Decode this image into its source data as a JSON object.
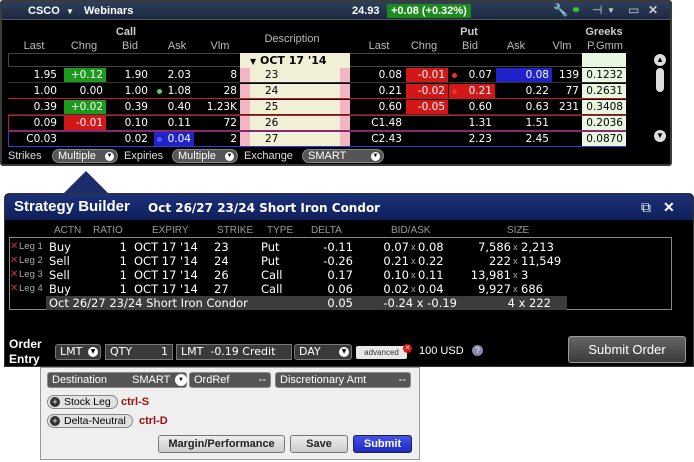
{
  "chain": {
    "symbol": "CSCO",
    "menu": "Webinars",
    "last_price": "24.93",
    "change": "+0.08 (+0.32%)",
    "headers": {
      "call_group": "Call",
      "put_group": "Put",
      "greeks_group": "Greeks",
      "description": "Description",
      "call_cols": [
        "Last",
        "Chng",
        "Bid",
        "Ask",
        "Vlm"
      ],
      "put_cols": [
        "Last",
        "Chng",
        "Bid",
        "Ask",
        "Vlm"
      ],
      "greek_col": "P.Gmm"
    },
    "expiry": "OCT 17 '14",
    "rows": [
      {
        "c_last": "1.95",
        "c_chng": "+0.12",
        "c_bid": "1.90",
        "c_ask": "2.03",
        "c_vlm": "8",
        "strike": "23",
        "p_last": "0.08",
        "p_chng": "-0.01",
        "p_bid": "0.07",
        "p_ask": "0.08",
        "p_vlm": "139",
        "gamma": "0.1232"
      },
      {
        "c_last": "1.00",
        "c_chng": "0.00",
        "c_bid": "1.00",
        "c_ask": "1.08",
        "c_vlm": "28",
        "strike": "24",
        "p_last": "0.21",
        "p_chng": "-0.02",
        "p_bid": "0.21",
        "p_ask": "0.22",
        "p_vlm": "77",
        "gamma": "0.2631"
      },
      {
        "c_last": "0.39",
        "c_chng": "+0.02",
        "c_bid": "0.39",
        "c_ask": "0.40",
        "c_vlm": "1.23K",
        "strike": "25",
        "p_last": "0.60",
        "p_chng": "-0.05",
        "p_bid": "0.60",
        "p_ask": "0.63",
        "p_vlm": "231",
        "gamma": "0.3408"
      },
      {
        "c_last": "0.09",
        "c_chng": "-0.01",
        "c_bid": "0.10",
        "c_ask": "0.11",
        "c_vlm": "72",
        "strike": "26",
        "p_last": "C1.48",
        "p_chng": "",
        "p_bid": "1.31",
        "p_ask": "1.51",
        "p_vlm": "",
        "gamma": "0.2036"
      },
      {
        "c_last": "C0.03",
        "c_chng": "",
        "c_bid": "0.02",
        "c_ask": "0.04",
        "c_vlm": "2",
        "strike": "27",
        "p_last": "C2.43",
        "p_chng": "",
        "p_bid": "2.23",
        "p_ask": "2.45",
        "p_vlm": "",
        "gamma": "0.0870"
      }
    ],
    "footer": {
      "strikes_label": "Strikes",
      "strikes_value": "Multiple",
      "expiries_label": "Expiries",
      "expiries_value": "Multiple",
      "exchange_label": "Exchange",
      "exchange_value": "SMART"
    }
  },
  "strategy": {
    "title": "Strategy Builder",
    "subtitle": "Oct 26/27 23/24 Short Iron Condor",
    "columns": [
      "ACTN",
      "RATIO",
      "EXPIRY",
      "STRIKE",
      "TYPE",
      "DELTA",
      "BID/ASK",
      "SIZE"
    ],
    "legs": [
      {
        "leg": "Leg 1",
        "action": "Buy",
        "ratio": "1",
        "expiry": "OCT 17 '14",
        "strike": "23",
        "type": "Put",
        "delta": "-0.11",
        "bid": "0.07",
        "ask": "0.08",
        "size_bid": "7,586",
        "size_ask": "2,213"
      },
      {
        "leg": "Leg 2",
        "action": "Sell",
        "ratio": "1",
        "expiry": "OCT 17 '14",
        "strike": "24",
        "type": "Put",
        "delta": "-0.26",
        "bid": "0.21",
        "ask": "0.22",
        "size_bid": "222",
        "size_ask": "11,549"
      },
      {
        "leg": "Leg 3",
        "action": "Sell",
        "ratio": "1",
        "expiry": "OCT 17 '14",
        "strike": "26",
        "type": "Call",
        "delta": "0.17",
        "bid": "0.10",
        "ask": "0.11",
        "size_bid": "13,981",
        "size_ask": "3"
      },
      {
        "leg": "Leg 4",
        "action": "Buy",
        "ratio": "1",
        "expiry": "OCT 17 '14",
        "strike": "27",
        "type": "Call",
        "delta": "0.06",
        "bid": "0.02",
        "ask": "0.04",
        "size_bid": "9,927",
        "size_ask": "686"
      }
    ],
    "combo": {
      "name": "Oct 26/27 23/24 Short Iron Condor",
      "delta": "0.05",
      "bidask": "-0.24 x -0.19",
      "size": "4 x 222"
    }
  },
  "order_entry": {
    "label_line1": "Order",
    "label_line2": "Entry",
    "order_type": "LMT",
    "qty_label": "QTY",
    "qty_value": "1",
    "price_type": "LMT",
    "price_value": "-0.19 Credit",
    "tif": "DAY",
    "advanced_label": "advanced",
    "cash_value": "100 USD",
    "submit_order_label": "Submit Order"
  },
  "advanced": {
    "destination_label": "Destination",
    "destination_value": "SMART",
    "ordref_label": "OrdRef",
    "ordref_value": "--",
    "discretionary_label": "Discretionary Amt",
    "discretionary_value": "--",
    "stock_leg_label": "Stock Leg",
    "stock_leg_hotkey": "ctrl-S",
    "delta_neutral_label": "Delta-Neutral",
    "delta_neutral_hotkey": "ctrl-D",
    "margin_btn": "Margin/Performance",
    "save_btn": "Save",
    "submit_btn": "Submit"
  },
  "colors": {
    "up": "#1d9a1d",
    "down": "#d11717",
    "select": "#1f23c9",
    "strike_bg": "#f1f0d6",
    "greek_bg": "#e8f7df",
    "builder_blue": "#1b2d6b"
  }
}
